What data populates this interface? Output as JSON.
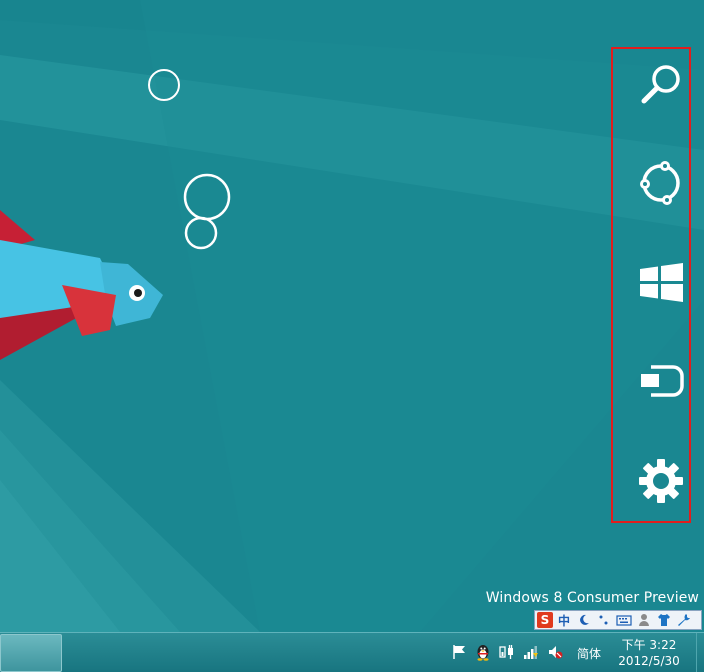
{
  "desktop": {
    "watermark": "Windows 8 Consumer Preview",
    "colors": {
      "background": "#1d8a94",
      "fish_body": "#46c4e4",
      "fish_fin": "#c62035"
    }
  },
  "charms": {
    "items": [
      {
        "id": "search",
        "icon": "search-icon"
      },
      {
        "id": "share",
        "icon": "share-icon"
      },
      {
        "id": "start",
        "icon": "windows-logo-icon"
      },
      {
        "id": "devices",
        "icon": "devices-icon"
      },
      {
        "id": "settings",
        "icon": "gear-icon"
      }
    ],
    "highlight_color": "#e21d1d"
  },
  "ime": {
    "logo": "S",
    "mode": "中",
    "buttons": [
      "moon-icon",
      "punctuation-icon",
      "keyboard-icon",
      "user-icon",
      "shirt-icon",
      "wrench-icon"
    ]
  },
  "taskbar": {
    "tray_icons": [
      "flag-icon",
      "qq-penguin-icon",
      "power-plug-icon",
      "network-signal-icon",
      "speaker-muted-icon"
    ],
    "language": "简体",
    "clock": {
      "time": "下午 3:22",
      "date": "2012/5/30"
    }
  }
}
